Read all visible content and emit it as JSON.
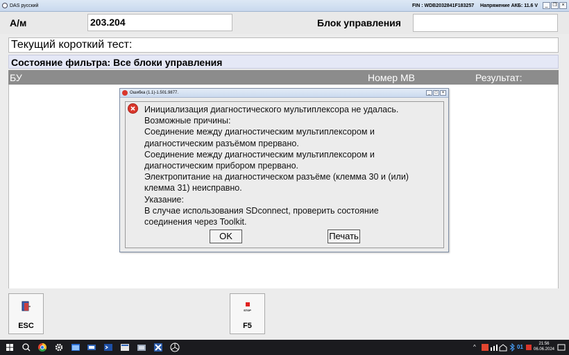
{
  "titlebar": {
    "app_name": "DAS русский",
    "fin": "FIN : WDB2032841F183257",
    "battery": "Напряжение АКБ: 11.6 V",
    "btn_minimize": "_",
    "btn_restore": "❐",
    "btn_close": "×"
  },
  "header": {
    "am_label": "А/м",
    "am_value": "203.204",
    "control_unit_label": "Блок управления",
    "control_unit_value": ""
  },
  "short_test": "Текущий короткий тест:",
  "filter_state": "Состояние фильтра: Все блоки управления",
  "columns": {
    "bu": "БУ",
    "mb_number": "Номер MB",
    "result": "Результат:"
  },
  "dialog": {
    "title": "Ошибка  (1.1)-1.501.9877.",
    "message_lines": [
      "Инициализация диагностического мультиплексора не удалась.",
      "Возможные причины:",
      "Соединение между диагностическим мультиплексором и",
      "диагностическим разъёмом прервано.",
      "Соединение между диагностическим мультиплексором и",
      "диагностическим прибором прервано.",
      "Электропитание на диагностическом разъёме (клемма 30 и (или)",
      "клемма 31) неисправно.",
      "Указание:",
      "В случае использования SDconnect, проверить состояние",
      "соединения через Toolkit."
    ],
    "ok_label": "OK",
    "print_label": "Печать",
    "btn_minimize": "_",
    "btn_restore": "□",
    "btn_close": "×"
  },
  "fkeys": {
    "esc_label": "ESC",
    "f5_label": "F5",
    "stop_text": "STOP"
  },
  "taskbar": {
    "time": "21:56",
    "date": "06.06.2024",
    "battery_num": "01"
  },
  "colors": {
    "column_header_bg": "#8c8c8c",
    "filter_bg": "#e5e8f6",
    "error_red": "#d9362b",
    "taskbar_bg": "#1b1b1f"
  }
}
